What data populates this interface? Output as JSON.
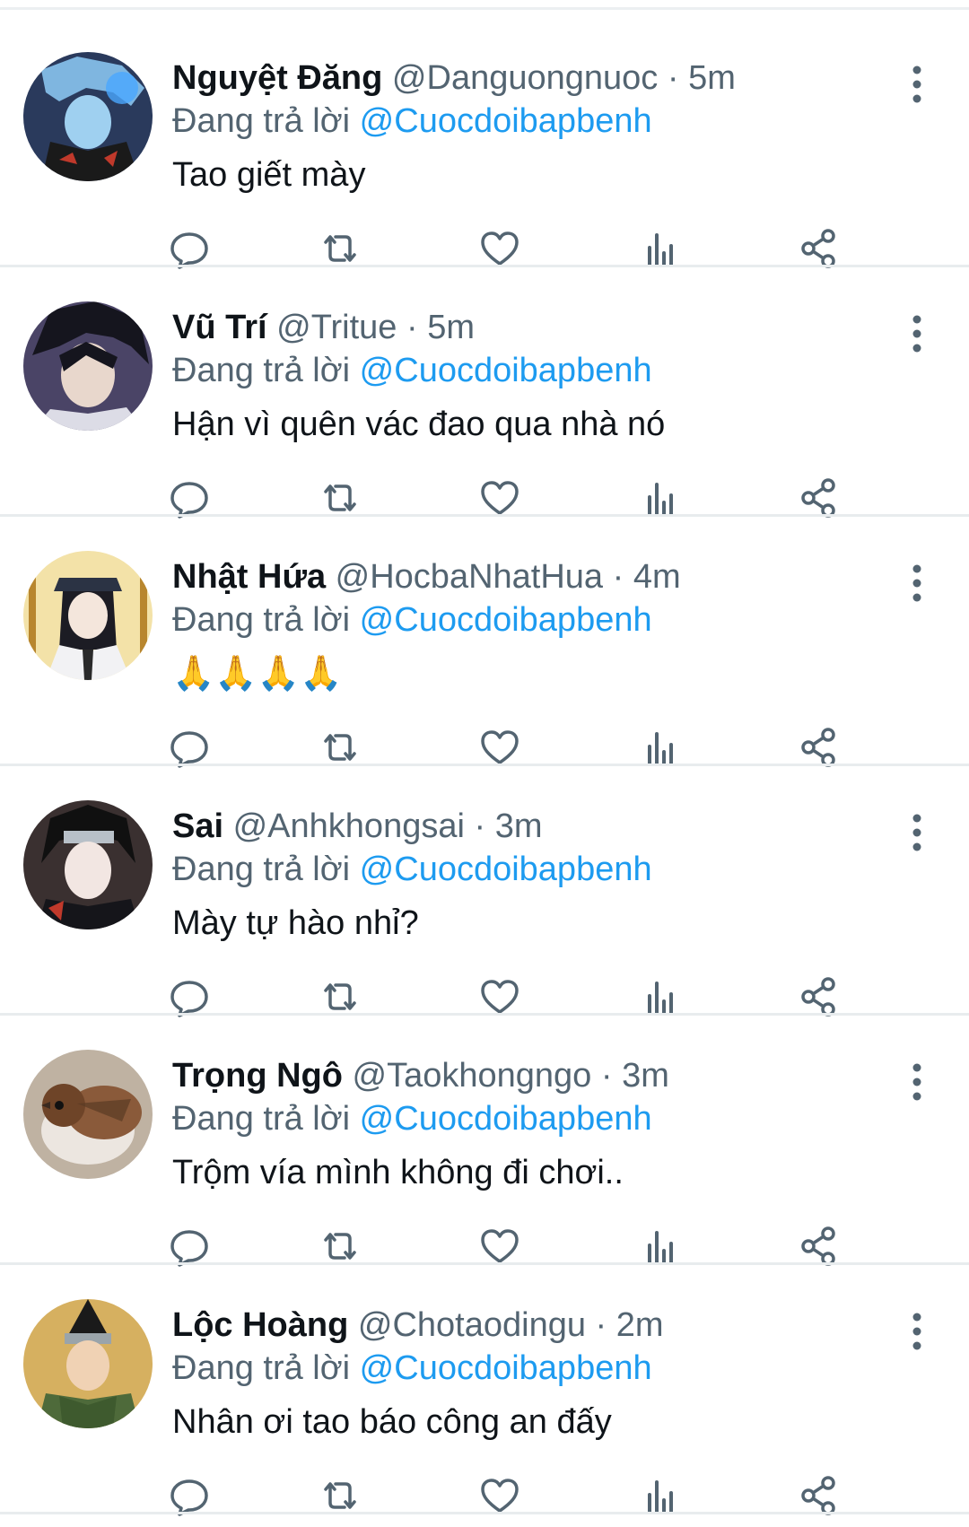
{
  "colors": {
    "accent": "#1d9bf0",
    "muted": "#536471",
    "text": "#0f1419",
    "divider": "#e8ecee"
  },
  "icons": {
    "more": "more-vertical-icon",
    "reply": "reply-icon",
    "retweet": "retweet-icon",
    "like": "heart-icon",
    "views": "views-icon",
    "share": "share-icon"
  },
  "tweets": [
    {
      "name": "Nguyệt Đăng",
      "handle": "@Danguongnuoc",
      "dot": "·",
      "time": "5m",
      "reply_prefix": "Đang trả lời",
      "reply_to": "@Cuocdoibapbenh",
      "text": "Tao giết mày"
    },
    {
      "name": "Vũ Trí",
      "handle": "@Tritue",
      "dot": "·",
      "time": "5m",
      "reply_prefix": "Đang trả lời",
      "reply_to": "@Cuocdoibapbenh",
      "text": "Hận vì quên vác đao qua nhà nó"
    },
    {
      "name": "Nhật Hứa",
      "handle": "@HocbaNhatHua",
      "dot": "·",
      "time": "4m",
      "reply_prefix": "Đang trả lời",
      "reply_to": "@Cuocdoibapbenh",
      "text": "🙏🙏🙏🙏"
    },
    {
      "name": "Sai",
      "handle": "@Anhkhongsai",
      "dot": "·",
      "time": "3m",
      "reply_prefix": "Đang trả lời",
      "reply_to": "@Cuocdoibapbenh",
      "text": "Mày tự hào nhỉ?"
    },
    {
      "name": "Trọng Ngô",
      "handle": "@Taokhongngo",
      "dot": "·",
      "time": "3m",
      "reply_prefix": "Đang trả lời",
      "reply_to": "@Cuocdoibapbenh",
      "text": "Trộm vía mình không đi chơi.."
    },
    {
      "name": "Lộc Hoàng",
      "handle": "@Chotaodingu",
      "dot": "·",
      "time": "2m",
      "reply_prefix": "Đang trả lời",
      "reply_to": "@Cuocdoibapbenh",
      "text": "Nhân ơi tao báo công an đấy"
    }
  ]
}
